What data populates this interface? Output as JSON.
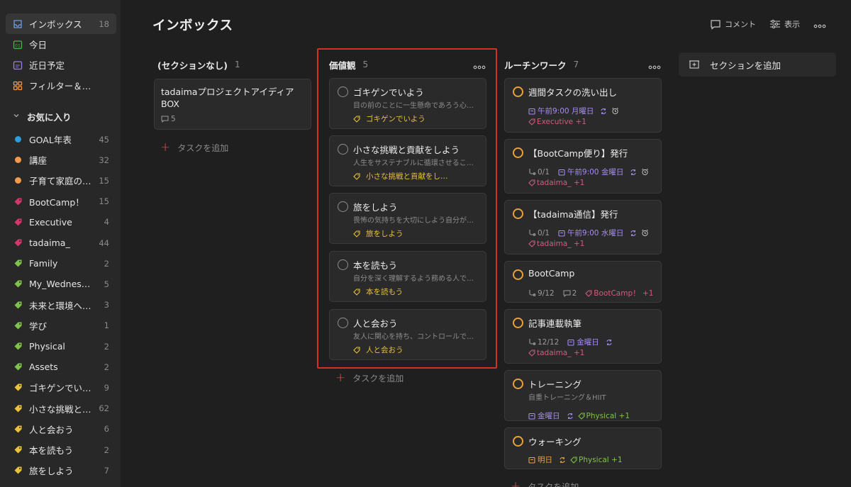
{
  "sidebar": {
    "nav": [
      {
        "label": "インボックス",
        "count": "18"
      },
      {
        "label": "今日",
        "count": ""
      },
      {
        "label": "近日予定",
        "count": ""
      },
      {
        "label": "フィルター＆ラベル",
        "count": ""
      }
    ],
    "favorites_header": "お気に入り",
    "favorites": [
      {
        "label": "GOAL年表",
        "count": "45",
        "color": "#2d9cdb",
        "kind": "dot"
      },
      {
        "label": "講座",
        "count": "32",
        "color": "#f2994a",
        "kind": "dot"
      },
      {
        "label": "子育て家庭の…",
        "count": "15",
        "color": "#f2994a",
        "kind": "dot"
      },
      {
        "label": "BootCamp！",
        "count": "15",
        "color": "#d2386c",
        "kind": "tag"
      },
      {
        "label": "Executive",
        "count": "4",
        "color": "#d2386c",
        "kind": "tag"
      },
      {
        "label": "tadaima_",
        "count": "44",
        "color": "#d2386c",
        "kind": "tag"
      },
      {
        "label": "Family",
        "count": "2",
        "color": "#7fc24b",
        "kind": "tag"
      },
      {
        "label": "My_Wednes…",
        "count": "5",
        "color": "#7fc24b",
        "kind": "tag"
      },
      {
        "label": "未来と環境へ…",
        "count": "3",
        "color": "#7fc24b",
        "kind": "tag"
      },
      {
        "label": "学び",
        "count": "1",
        "color": "#7fc24b",
        "kind": "tag"
      },
      {
        "label": "Physical",
        "count": "2",
        "color": "#7fc24b",
        "kind": "tag"
      },
      {
        "label": "Assets",
        "count": "2",
        "color": "#7fc24b",
        "kind": "tag"
      },
      {
        "label": "ゴキゲンでい…",
        "count": "9",
        "color": "#e8c23a",
        "kind": "tag"
      },
      {
        "label": "小さな挑戦と…",
        "count": "62",
        "color": "#e8c23a",
        "kind": "tag"
      },
      {
        "label": "人と会おう",
        "count": "6",
        "color": "#e8c23a",
        "kind": "tag"
      },
      {
        "label": "本を読もう",
        "count": "2",
        "color": "#e8c23a",
        "kind": "tag"
      },
      {
        "label": "旅をしよう",
        "count": "7",
        "color": "#e8c23a",
        "kind": "tag"
      }
    ]
  },
  "header": {
    "title": "インボックス",
    "comment_label": "コメント",
    "view_label": "表示"
  },
  "columns": {
    "none": {
      "title": "(セクションなし)",
      "count": "1"
    },
    "values": {
      "title": "価値観",
      "count": "5"
    },
    "routine": {
      "title": "ルーチンワーク",
      "count": "7"
    }
  },
  "add_task_label": "タスクを追加",
  "add_section_label": "セクションを追加",
  "none_card": {
    "title_line1": "tadaimaプロジェクトアイディア",
    "title_line2": "BOX",
    "comments": "5"
  },
  "values_cards": [
    {
      "title": "ゴキゲンでいよう",
      "desc": "目の前のことに一生懸命であろう心がけよう",
      "tag": "ゴキゲンでいよう"
    },
    {
      "title": "小さな挑戦と貢献をしよう",
      "desc": "人生をサステナブルに循環させることを意識しよう",
      "tag": "小さな挑戦と貢献をし…"
    },
    {
      "title": "旅をしよう",
      "desc": "畏怖の気持ちを大切にしよう自分が小さく感じる体験",
      "tag": "旅をしよう"
    },
    {
      "title": "本を読もう",
      "desc": "自分を深く理解するよう務める人でいよう",
      "tag": "本を読もう"
    },
    {
      "title": "人と会おう",
      "desc": "友人に関心を持ち、コントロールできないものを受け入れよう",
      "tag": "人と会おう"
    }
  ],
  "routine_cards": [
    {
      "title": "週間タスクの洗い出し",
      "sub": "",
      "date": "午前9:00 月曜日",
      "tag": "Executive +1",
      "tag_color": "pink",
      "alarm": true,
      "progress": "",
      "comments": ""
    },
    {
      "title": "【BootCamp便り】発行",
      "sub": "",
      "progress": "0/1",
      "date": "午前9:00 金曜日",
      "tag": "tadaima_ +1",
      "tag_color": "pink",
      "alarm": true,
      "comments": ""
    },
    {
      "title": "【tadaima通信】発行",
      "sub": "",
      "progress": "0/1",
      "date": "午前9:00 水曜日",
      "tag": "tadaima_ +1",
      "tag_color": "pink",
      "alarm": true,
      "comments": ""
    },
    {
      "title": "BootCamp",
      "sub": "",
      "progress": "9/12",
      "comments": "2",
      "tag": "BootCamp！ +1",
      "tag_color": "pink",
      "date": "",
      "alarm": false
    },
    {
      "title": "記事連載執筆",
      "sub": "",
      "progress": "12/12",
      "date": "金曜日",
      "tag": "tadaima_ +1",
      "tag_color": "pink",
      "alarm": false,
      "comments": ""
    },
    {
      "title": "トレーニング",
      "sub": "自重トレーニング＆HIIT",
      "date": "金曜日",
      "tag": "Physical +1",
      "tag_color": "green",
      "alarm": false,
      "progress": "",
      "comments": ""
    },
    {
      "title": "ウォーキング",
      "sub": "",
      "date": "明日",
      "tag": "Physical +1",
      "tag_color": "green",
      "alarm": false,
      "progress": "",
      "comments": ""
    }
  ],
  "colors": {
    "accent_red": "#d6301f",
    "priority_orange": "#e8a23a",
    "bg": "#1f1f1f",
    "sidebar_bg": "#282828"
  }
}
